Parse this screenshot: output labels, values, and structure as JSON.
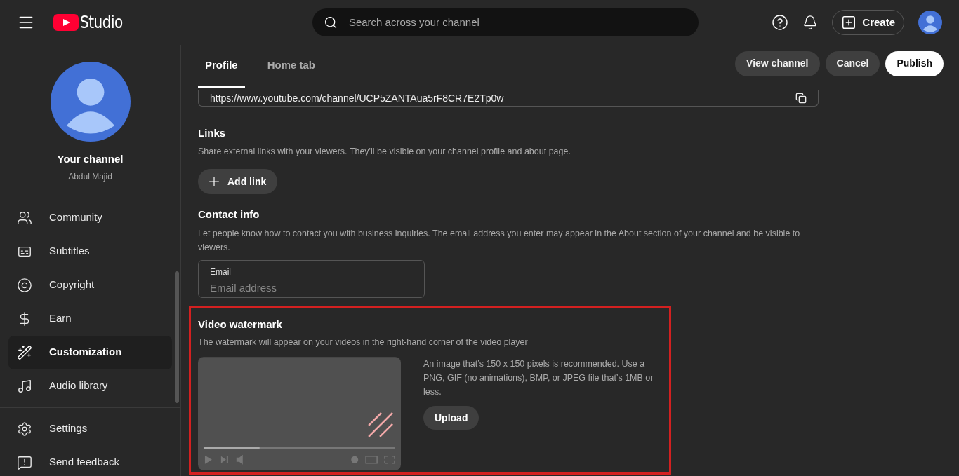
{
  "header": {
    "logo_text": "Studio",
    "search": {
      "placeholder": "Search across your channel"
    },
    "create_label": "Create"
  },
  "sidebar": {
    "channel_title": "Your channel",
    "channel_name": "Abdul Majid",
    "items": [
      {
        "kind": "community",
        "label": "Community",
        "selected": false
      },
      {
        "kind": "subtitles",
        "label": "Subtitles",
        "selected": false
      },
      {
        "kind": "copyright",
        "label": "Copyright",
        "selected": false
      },
      {
        "kind": "earn",
        "label": "Earn",
        "selected": false
      },
      {
        "kind": "customization",
        "label": "Customization",
        "selected": true
      },
      {
        "kind": "audio",
        "label": "Audio library",
        "selected": false
      }
    ],
    "footer_items": [
      {
        "kind": "settings",
        "label": "Settings"
      },
      {
        "kind": "feedback",
        "label": "Send feedback"
      }
    ]
  },
  "tabs": [
    {
      "label": "Profile",
      "selected": true
    },
    {
      "label": "Home tab",
      "selected": false
    }
  ],
  "actions": [
    {
      "label": "View channel",
      "kind": "secondary"
    },
    {
      "label": "Cancel",
      "kind": "secondary"
    },
    {
      "label": "Publish",
      "kind": "primary"
    }
  ],
  "channel_url": "https://www.youtube.com/channel/UCP5ZANTAua5rF8CR7E2Tp0w",
  "links": {
    "title": "Links",
    "description": "Share external links with your viewers. They'll be visible on your channel profile and about page.",
    "button": "Add link"
  },
  "contact": {
    "title": "Contact info",
    "description": "Let people know how to contact you with business inquiries. The email address you enter may appear in the About section of your channel and be visible to viewers.",
    "field_label": "Email",
    "placeholder": "Email address"
  },
  "watermark": {
    "title": "Video watermark",
    "description": "The watermark will appear on your videos in the right-hand corner of the video player",
    "hint": "An image that’s 150 x 150 pixels is recommended. Use a PNG, GIF (no animations), BMP, or JPEG file that’s 1MB or less.",
    "button": "Upload"
  }
}
